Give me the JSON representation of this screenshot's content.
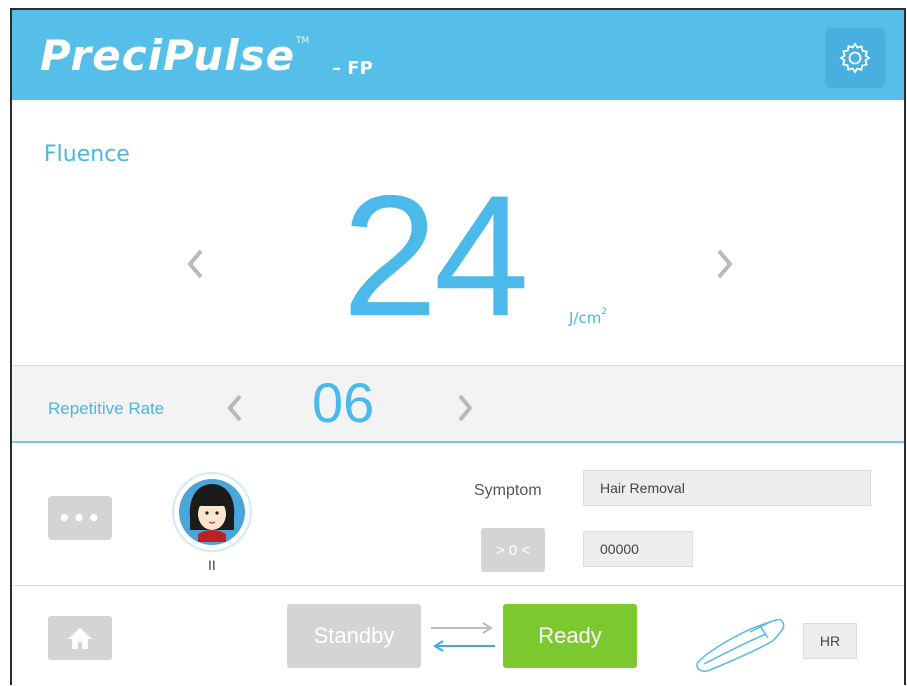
{
  "header": {
    "brand": "PreciPulse",
    "trademark": "TM",
    "model": "– FP",
    "settings_icon": "gear-icon"
  },
  "fluence": {
    "label": "Fluence",
    "value": "24",
    "unit": "J/cm",
    "unit_sup": "2",
    "decrease_icon": "chevron-left-icon",
    "increase_icon": "chevron-right-icon"
  },
  "rate": {
    "label": "Repetitive Rate",
    "value": "06"
  },
  "profile": {
    "more_label": "•••",
    "avatar_icon": "face-avatar-icon",
    "skin_type": "II"
  },
  "symptom": {
    "label": "Symptom",
    "value": "Hair Removal"
  },
  "counter": {
    "reset_label": "> 0 <",
    "value": "00000"
  },
  "controls": {
    "home_icon": "home-icon",
    "standby_label": "Standby",
    "ready_label": "Ready",
    "swap_icon": "swap-arrows-icon",
    "handpiece_icon": "handpiece-icon",
    "handpiece_label": "HR"
  },
  "colors": {
    "header": "#56bfe9",
    "accent": "#4bb9ea",
    "ready": "#7cc82f",
    "inactive": "#d4d4d4"
  }
}
